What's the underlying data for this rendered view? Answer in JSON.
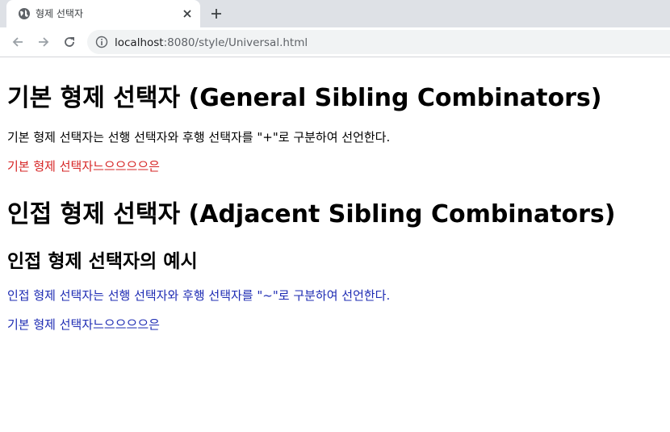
{
  "browser": {
    "tab_title": "형제 선택자",
    "url_host": "localhost",
    "url_path": ":8080/style/Universal.html"
  },
  "page": {
    "heading1": "기본 형제 선택자 (General Sibling Combinators)",
    "para1": "기본 형제 선택자는 선행 선택자와 후행 선택자를 \"+\"로 구분하여 선언한다.",
    "para2": "기본 형제 선택자느으으으으은",
    "heading2": "인접 형제 선택자 (Adjacent Sibling Combinators)",
    "heading3": "인접 형제 선택자의 예시",
    "para3": "인접 형제 선택자는 선행 선택자와 후행 선택자를 \"~\"로 구분하여 선언한다.",
    "para4": "기본 형제 선택자느으으으으은"
  },
  "colors": {
    "red_text": "#d62424",
    "blue_text": "#1d2bb3"
  }
}
